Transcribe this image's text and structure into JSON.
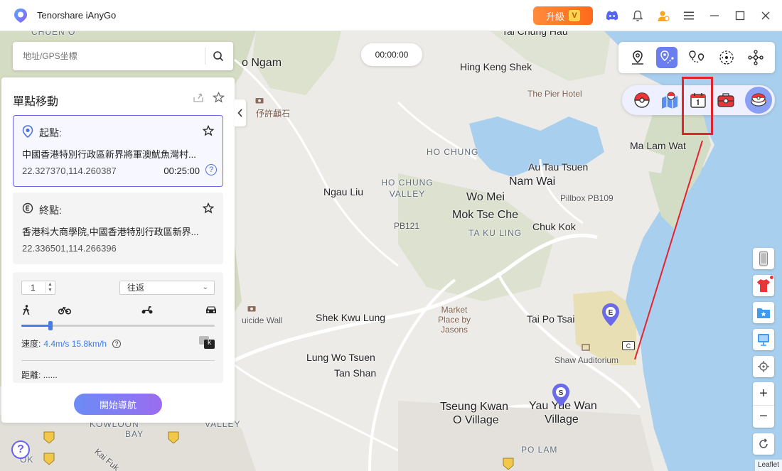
{
  "titlebar": {
    "app_title": "Tenorshare iAnyGo",
    "upgrade_label": "升級",
    "vip_badge": "V"
  },
  "search": {
    "placeholder": "地址/GPS坐標"
  },
  "timer": "00:00:00",
  "panel": {
    "title": "單點移動",
    "start": {
      "label": "起點:",
      "address": "中國香港特別行政區新界將軍澳魷魚灣村...",
      "coords": "22.327370,114.260387",
      "time": "00:25:00",
      "help": "?"
    },
    "end": {
      "label": "終點:",
      "address": "香港科大商學院,中國香港特別行政區新界...",
      "coords": "22.336501,114.266396"
    },
    "settings": {
      "count_value": "1",
      "mode_value": "往返",
      "speed_label": "速度:",
      "speed_value": "4.4m/s 15.8km/h",
      "speed_level": 0.15,
      "unit_toggle": "k",
      "distance_label": "距離:",
      "distance_value": "......"
    },
    "start_nav_label": "開始導航"
  },
  "map": {
    "labels": [
      {
        "text": "CHUEN O",
        "style": "caps"
      },
      {
        "text": "o Ngam",
        "style": "big"
      },
      {
        "text": "伃許顱石",
        "style": "brown"
      },
      {
        "text": "Tai Chung Hau",
        "style": "normal"
      },
      {
        "text": "Hing Keng Shek",
        "style": "normal"
      },
      {
        "text": "The Pier Hotel",
        "style": "brown"
      },
      {
        "text": "Ma Lam Wat",
        "style": "normal"
      },
      {
        "text": "HO CHUNG",
        "style": "caps"
      },
      {
        "text": "Au Tau Tsuen",
        "style": "normal"
      },
      {
        "text": "Nam Wai",
        "style": "big"
      },
      {
        "text": "Pillbox PB109",
        "style": "small"
      },
      {
        "text": "Ngau Liu",
        "style": "normal"
      },
      {
        "text": "HO CHUNG VALLEY",
        "style": "caps"
      },
      {
        "text": "Wo Mei",
        "style": "big"
      },
      {
        "text": "Mok Tse Che",
        "style": "big"
      },
      {
        "text": "PB121",
        "style": "small"
      },
      {
        "text": "TA KU LING",
        "style": "caps"
      },
      {
        "text": "Chuk Kok",
        "style": "normal"
      },
      {
        "text": "Market Place by Jasons",
        "style": "brown"
      },
      {
        "text": "Shek Kwu Lung",
        "style": "normal"
      },
      {
        "text": "Tai Po Tsai",
        "style": "normal"
      },
      {
        "text": "uicide Wall",
        "style": "small"
      },
      {
        "text": "Shaw Auditorium",
        "style": "small"
      },
      {
        "text": "Lung Wo Tsuen",
        "style": "normal"
      },
      {
        "text": "Tan Shan",
        "style": "normal"
      },
      {
        "text": "Tseung Kwan",
        "style": "big"
      },
      {
        "text": "O Village",
        "style": "big"
      },
      {
        "text": "Yau Yue Wan",
        "style": "big"
      },
      {
        "text": "Village",
        "style": "big"
      },
      {
        "text": "KOWLOON",
        "style": "caps"
      },
      {
        "text": "BAY",
        "style": "caps"
      },
      {
        "text": "VALLEY",
        "style": "caps"
      },
      {
        "text": "PO LAM",
        "style": "caps"
      },
      {
        "text": "Kai Fuk",
        "style": "small"
      },
      {
        "text": "OK",
        "style": "caps"
      }
    ],
    "route_badges": [
      "5",
      "2",
      "6",
      "7"
    ],
    "marker_start": "S",
    "marker_end": "E",
    "marker_tag": "C"
  },
  "controls": {
    "zoom_in": "+",
    "zoom_out": "−",
    "help": "?"
  },
  "attribution": "Leaflet",
  "colors": {
    "accent": "#6a7ef0",
    "upgrade": "#ff7a2a",
    "annotation": "#e4232c",
    "water": "#a9cfee",
    "park": "#d4dcc3"
  }
}
